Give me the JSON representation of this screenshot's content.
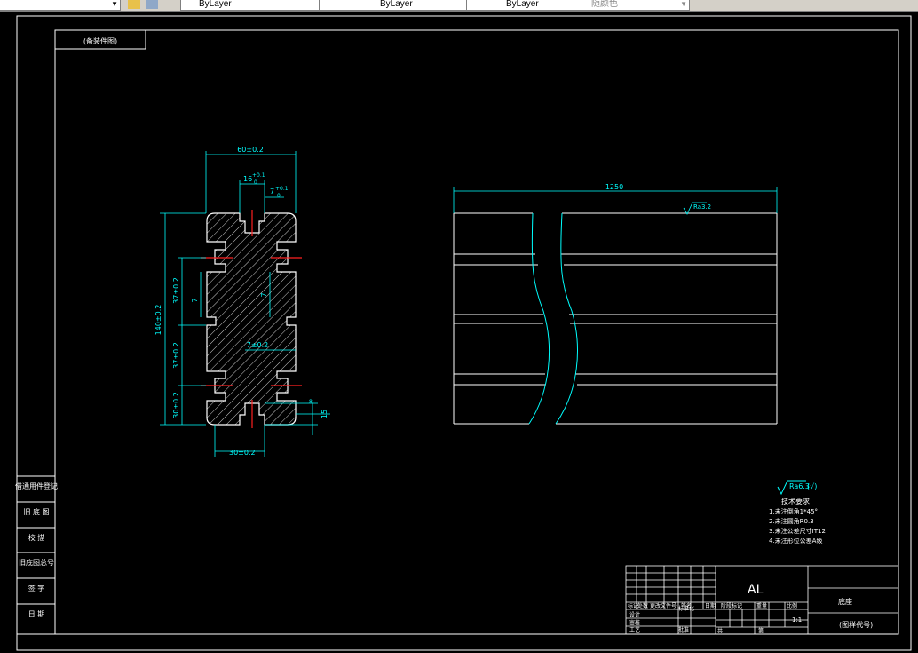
{
  "toolbar": {
    "color_value": "ByLayer",
    "linetype_value": "ByLayer",
    "lineweight_value": "ByLayer",
    "plotstyle_value": "随颜色"
  },
  "drawing": {
    "top_label": "(备装件图)",
    "left_panel": [
      "借通用件登记",
      "旧 底 图",
      "校 描",
      "旧底图总号",
      "签 字",
      "日 期"
    ],
    "dims": {
      "overall_width": "60±0.2",
      "slot_width": "16",
      "slot_tol_top": "+0.1",
      "slot_tol_bot": "0",
      "slot_depth": "7",
      "slot_depth_tol_top": "+0.1",
      "slot_depth_tol_bot": "0",
      "overall_height": "140±0.2",
      "side_d1": "37±0.2",
      "side_d2": "37±0.2",
      "side_d3": "30±0.2",
      "inner_v": "7",
      "inner_h": "7±0.2",
      "bottom_width": "30±0.2",
      "right_small": "8",
      "right_small2": "15",
      "length": "1250",
      "roughness_top": "Ra3.2"
    },
    "notes": {
      "roughness": "Ra6.3",
      "title": "技术要求",
      "items": [
        "1.未注倒角1*45°",
        "2.未注圆角R0.3",
        "3.未注公差尺寸IT12",
        "4.未注形位公差A级"
      ]
    },
    "title_block": {
      "material": "AL",
      "part_name": "底座",
      "drawing_no": "(图样代号)",
      "scale": "1:1",
      "row_labels": [
        "标记",
        "处数",
        "更改文件号",
        "签名",
        "日期"
      ],
      "design": "设计",
      "standard": "标准化",
      "process": "工艺",
      "approve": "批准",
      "check": "审核",
      "stage": "阶段标记",
      "weight": "重量",
      "ratio": "比例",
      "sheets": "共",
      "sheet": "第"
    }
  }
}
